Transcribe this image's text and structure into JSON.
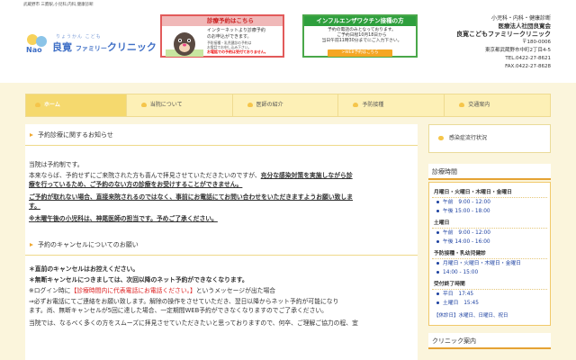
{
  "top_strip": "武蔵野市 三鷹駅,小児科,内科,健康診断",
  "logo": {
    "furigana": "りょうかん こども",
    "name_main": "良寛",
    "name_small": "ファミリー",
    "name_end": "クリニック"
  },
  "banner_reservation": {
    "title": "診療予約はこちら",
    "text1": "インターネットより診療予約\nのお申込ができます。",
    "text2": "予防接種・乳児健診の予約は\nお電話でお申し込み下さい。",
    "text3": "お電話での予約は受付ておりません。"
  },
  "banner_vaccine": {
    "title": "インフルエンザワクチン接種の方",
    "text": "予約の電話のみとなっております。\nご予約日程10月18日から\n当日午前11時30分までにご入力下さい。",
    "button": ">WEB予約はこちら"
  },
  "clinic": {
    "tagline": "小児科・内科・健康診断",
    "corp": "医療法人社団良寛会",
    "name": "良寛こどもファミリークリニック",
    "zip": "〒180-0006",
    "address": "東京都武蔵野市中町2丁目4-5",
    "tel": "TEL.0422-27-8621",
    "fax": "FAX.0422-27-8628"
  },
  "nav": [
    "ホーム",
    "当院について",
    "医師の紹介",
    "予防接種",
    "交通案内"
  ],
  "main": {
    "section1_title": "予約診療に関するお知らせ",
    "p1": "当院は予約制です。",
    "p2a": "本来ならば、予約せずにご来院された方も喜んで拝見させていただきたいのですが、",
    "p2b": "充分な感染対策を実施しながら診",
    "p2c": "療を行っているため、ご予約のない方の診療をお受けすることができません。",
    "p3": "ご予約が取れない場合、直接来院されるのではなく、事前にお電話にてお問い合わせをいただきますようお願い致しま",
    "p3b": "す。",
    "p4": "※木曜午後の小児科は、神尾医師の担当です。予めご了承ください。",
    "section2_title": "予約のキャンセルについてのお願い",
    "c1": "＊直前のキャンセルはお控えください。",
    "c2": "＊無断キャンセルにつきましては、次回以降のネット予約ができなくなります。",
    "c3a": "※ログイン時に",
    "c3b": "【診療時間内に代表電話にお電話ください。】",
    "c3c": "というメッセージが出た場合",
    "c4": "⇒必ずお電話にてご連絡をお願い致します。解除の操作をさせていただき、翌日以降からネット予約が可能になり",
    "c5": "ます。尚、無断キャンセルが5回に達した場合、一定期間WEB予約ができなくなりますのでご了承ください。",
    "c6": "当院では、なるべく多くの方をスムーズに拝見させていただきたいと思っておりますので、何卒、ご理解ご協力の程、宜"
  },
  "sidebar": {
    "infection_btn": "感染症流行状況",
    "hours_title": "診療時間",
    "blocks": [
      {
        "title": "月曜日・火曜日・木曜日・金曜日",
        "lines": [
          "午前　9:00 - 12:00",
          "午後 15:00 - 18:00"
        ]
      },
      {
        "title": "土曜日",
        "lines": [
          "午前　9:00 - 12:00",
          "午後 14:00 - 16:00"
        ]
      },
      {
        "title": "予防接種・乳幼児健診",
        "lines": [
          "月曜日・火曜日・木曜日・金曜日",
          "14:00 - 15:00"
        ]
      },
      {
        "title": "受付終了時間",
        "lines": [
          "平日　17:45",
          "土曜日　15:45"
        ]
      }
    ],
    "closed_label": "【休診日】",
    "closed_days": "水曜日、日曜日、祝日",
    "guide_title": "クリニック案内"
  },
  "colors": {
    "accent": "#f5d96e",
    "link_blue": "#1a3fa0",
    "warn_red": "#d22222"
  }
}
